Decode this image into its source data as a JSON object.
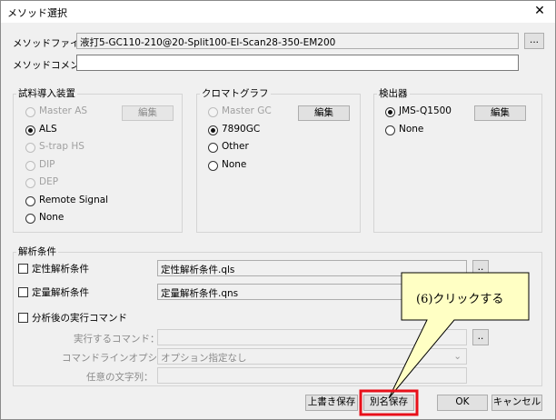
{
  "window": {
    "title": "メソッド選択",
    "close_glyph": "✕"
  },
  "method_file": {
    "label": "メソッドファイル：",
    "value": "液打5-GC110-210@20-Split100-EI-Scan28-350-EM200",
    "browse": "..."
  },
  "method_comment": {
    "label": "メソッドコメント：",
    "value": ""
  },
  "inlet": {
    "title": "試料導入装置",
    "edit": "編集",
    "options": [
      {
        "label": "Master AS",
        "enabled": false,
        "selected": false
      },
      {
        "label": "ALS",
        "enabled": true,
        "selected": true
      },
      {
        "label": "S-trap HS",
        "enabled": false,
        "selected": false
      },
      {
        "label": "DIP",
        "enabled": false,
        "selected": false
      },
      {
        "label": "DEP",
        "enabled": false,
        "selected": false
      },
      {
        "label": "Remote Signal",
        "enabled": true,
        "selected": false
      },
      {
        "label": "None",
        "enabled": true,
        "selected": false
      }
    ]
  },
  "gc": {
    "title": "クロマトグラフ",
    "edit": "編集",
    "options": [
      {
        "label": "Master GC",
        "enabled": false,
        "selected": false
      },
      {
        "label": "7890GC",
        "enabled": true,
        "selected": true
      },
      {
        "label": "Other",
        "enabled": true,
        "selected": false
      },
      {
        "label": "None",
        "enabled": true,
        "selected": false
      }
    ]
  },
  "detector": {
    "title": "検出器",
    "edit": "編集",
    "options": [
      {
        "label": "JMS-Q1500",
        "enabled": true,
        "selected": true
      },
      {
        "label": "None",
        "enabled": true,
        "selected": false
      }
    ]
  },
  "analysis": {
    "title": "解析条件",
    "qual": {
      "label": "定性解析条件",
      "value": "定性解析条件.qls",
      "browse": ".."
    },
    "quant": {
      "label": "定量解析条件",
      "value": "定量解析条件.qns",
      "browse": ".."
    },
    "post": {
      "label": "分析後の実行コマンド"
    },
    "cmd": {
      "label": "実行するコマンド：",
      "value": "",
      "browse": ".."
    },
    "cmd_option": {
      "label": "コマンドラインオプション：",
      "value": "オプション指定なし"
    },
    "any_string": {
      "label": "任意の文字列：",
      "value": ""
    }
  },
  "footer": {
    "overwrite": "上書き保存",
    "save_as": "別名保存",
    "ok": "OK",
    "cancel": "キャンセル"
  },
  "callout": {
    "text": "(6)クリックする",
    "highlight_color": "#e8101a",
    "fill_color": "#ffffc4"
  }
}
